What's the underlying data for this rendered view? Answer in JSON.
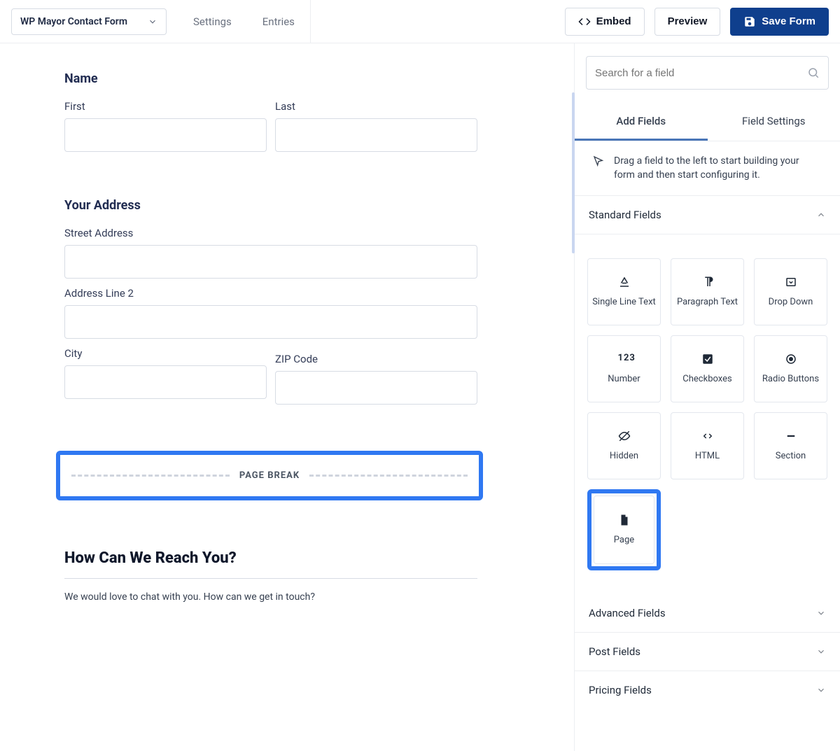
{
  "topbar": {
    "form_name": "WP Mayor Contact Form",
    "nav": {
      "settings": "Settings",
      "entries": "Entries"
    },
    "embed": "Embed",
    "preview": "Preview",
    "save": "Save Form"
  },
  "canvas": {
    "name_block": {
      "title": "Name",
      "first": "First",
      "last": "Last"
    },
    "address_block": {
      "title": "Your Address",
      "street": "Street Address",
      "line2": "Address Line 2",
      "city": "City",
      "zip": "ZIP Code"
    },
    "page_break_label": "PAGE BREAK",
    "reach": {
      "heading": "How Can We Reach You?",
      "desc": "We would love to chat with you. How can we get in touch?"
    }
  },
  "sidebar": {
    "search_placeholder": "Search for a field",
    "tabs": {
      "add": "Add Fields",
      "settings": "Field Settings"
    },
    "hint": "Drag a field to the left to start building your form and then start configuring it.",
    "groups": {
      "standard": "Standard Fields",
      "advanced": "Advanced Fields",
      "post": "Post Fields",
      "pricing": "Pricing Fields"
    },
    "fields": {
      "single_line": "Single Line Text",
      "paragraph": "Paragraph Text",
      "dropdown": "Drop Down",
      "number": "Number",
      "checkboxes": "Checkboxes",
      "radio": "Radio Buttons",
      "hidden": "Hidden",
      "html": "HTML",
      "section": "Section",
      "page": "Page"
    }
  }
}
